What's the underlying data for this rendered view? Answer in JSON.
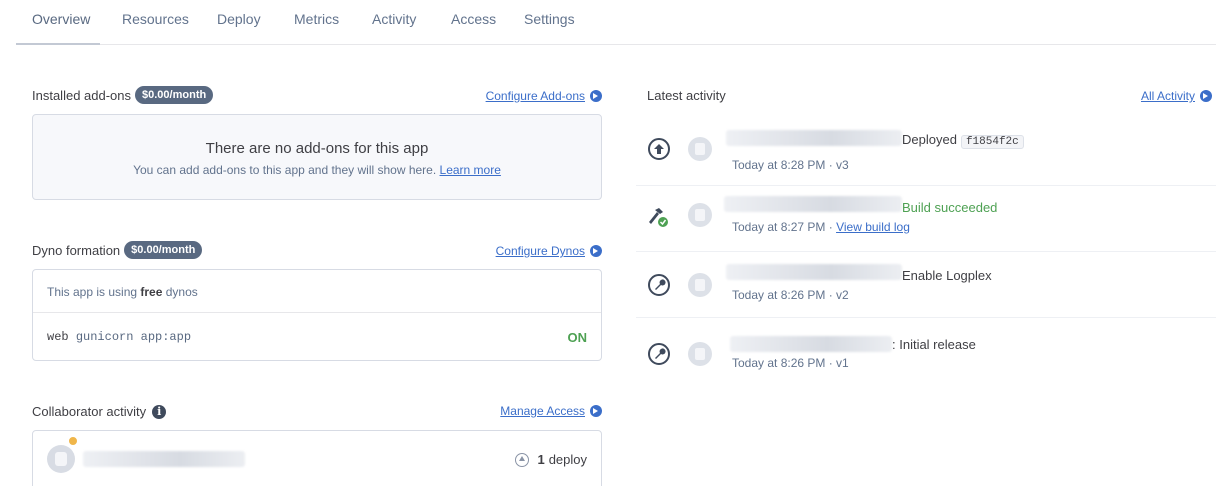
{
  "tabs": [
    {
      "label": "Overview"
    },
    {
      "label": "Resources"
    },
    {
      "label": "Deploy"
    },
    {
      "label": "Metrics"
    },
    {
      "label": "Activity"
    },
    {
      "label": "Access"
    },
    {
      "label": "Settings"
    }
  ],
  "addons": {
    "title": "Installed add-ons",
    "badge": "$0.00/month",
    "configure_link": "Configure Add-ons",
    "empty_title": "There are no add-ons for this app",
    "empty_sub": "You can add add-ons to this app and they will show here.",
    "learn_more": "Learn more"
  },
  "dynos": {
    "title": "Dyno formation",
    "badge": "$0.00/month",
    "configure_link": "Configure Dynos",
    "info_prefix": "This app is using",
    "info_bold": "free",
    "info_suffix": "dynos",
    "process_type": "web",
    "command": "gunicorn app:app",
    "state": "ON"
  },
  "collaborators": {
    "title": "Collaborator activity",
    "manage_link": "Manage Access",
    "deploy_count": "1",
    "deploy_label": "deploy"
  },
  "activity": {
    "title": "Latest activity",
    "all_link": "All Activity",
    "items": [
      {
        "icon": "deploy-icon",
        "action": "Deployed",
        "commit": "f1854f2c",
        "time": "Today at 8:28 PM · v3"
      },
      {
        "icon": "build-hammer-icon",
        "action": "Build succeeded",
        "time": "Today at 8:27 PM · ",
        "link": "View build log"
      },
      {
        "icon": "wrench-icon",
        "action": "Enable Logplex",
        "time": "Today at 8:26 PM · v2"
      },
      {
        "icon": "wrench-icon",
        "action": ": Initial release",
        "time": "Today at 8:26 PM · v1"
      }
    ]
  },
  "colors": {
    "accent": "#3b6ec9",
    "badge": "#596981",
    "success": "#4ea153"
  }
}
